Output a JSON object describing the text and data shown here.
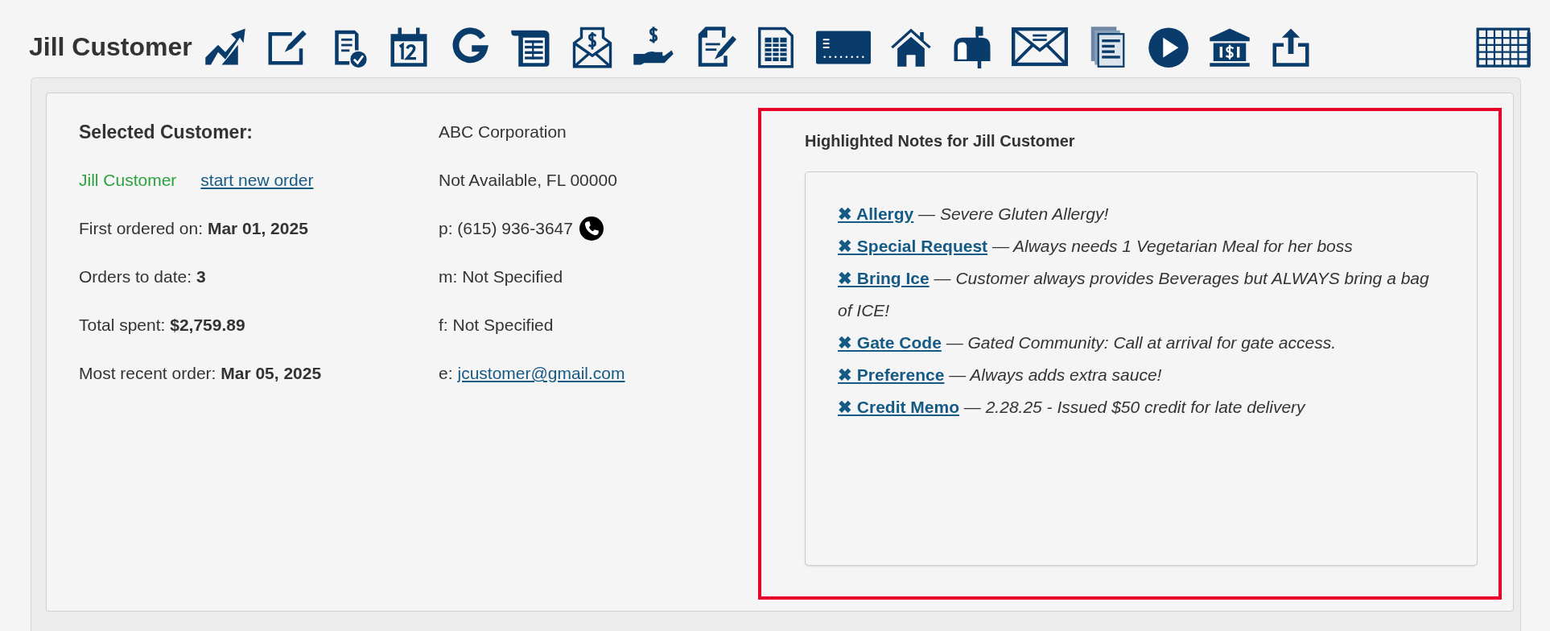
{
  "header": {
    "title": "Jill Customer"
  },
  "customer": {
    "heading": "Selected Customer:",
    "name": "Jill Customer",
    "new_order_link": "start new order",
    "stats": [
      {
        "label": "First ordered on:",
        "value": "Mar 01, 2025"
      },
      {
        "label": "Orders to date:",
        "value": "3"
      },
      {
        "label": "Total spent:",
        "value": "$2,759.89"
      },
      {
        "label": "Most recent order:",
        "value": "Mar 05, 2025"
      }
    ],
    "contact": [
      {
        "kind": "text",
        "text": "ABC Corporation"
      },
      {
        "kind": "text",
        "text": "Not Available, FL 00000"
      },
      {
        "kind": "phone",
        "text": "p: (615) 936-3647"
      },
      {
        "kind": "text",
        "text": "m: Not Specified"
      },
      {
        "kind": "text",
        "text": "f: Not Specified"
      },
      {
        "kind": "email",
        "text": "e:",
        "link": "jcustomer@gmail.com"
      }
    ]
  },
  "notes": {
    "heading": "Highlighted Notes for Jill Customer",
    "items": [
      {
        "tag": "✖ Allergy",
        "text": "— Severe Gluten Allergy!"
      },
      {
        "tag": "✖ Special Request",
        "text": "— Always needs 1 Vegetarian Meal for her boss"
      },
      {
        "tag": "✖ Bring Ice",
        "text": "— Customer always provides Beverages but ALWAYS bring a bag of ICE!"
      },
      {
        "tag": "✖ Gate Code",
        "text": "— Gated Community: Call at arrival for gate access."
      },
      {
        "tag": "✖ Preference",
        "text": "— Always adds extra sauce!"
      },
      {
        "tag": "✖ Credit Memo",
        "text": "— 2.28.25 - Issued $50 credit for late delivery"
      }
    ]
  }
}
